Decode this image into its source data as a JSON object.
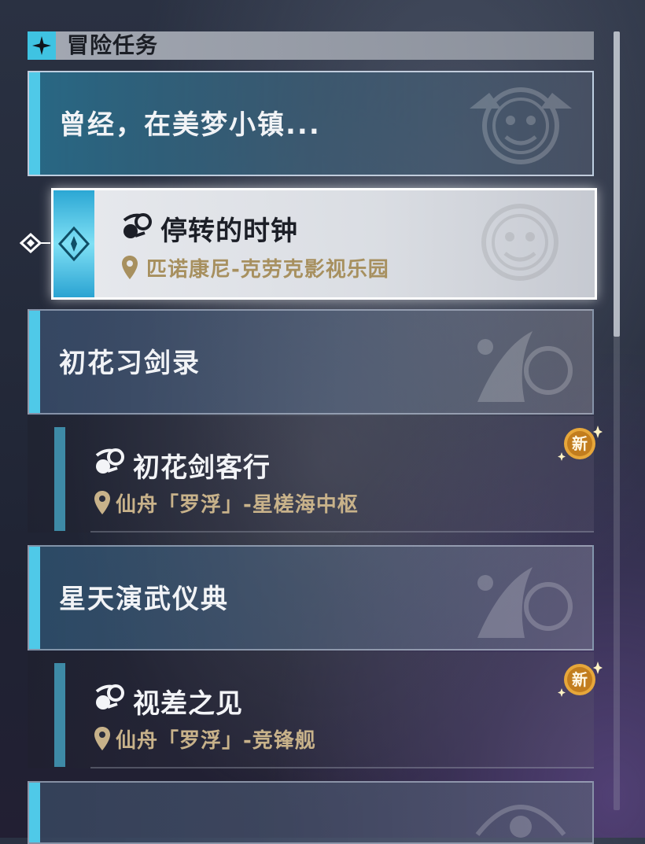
{
  "header": {
    "title": "冒险任务",
    "icon": "diamond-star-icon"
  },
  "categories": [
    {
      "title": "曾经，在美梦小镇...",
      "emblem": "clock-face-emblem"
    },
    {
      "title": "初花习剑录",
      "emblem": "xianzhou-emblem"
    },
    {
      "title": "星天演武仪典",
      "emblem": "xianzhou-emblem"
    },
    {
      "title": "",
      "emblem": "penacony-emblem"
    }
  ],
  "missions": [
    {
      "title": "停转的时钟",
      "location": "匹诺康尼-克劳克影视乐园",
      "selected": true,
      "is_new": false,
      "icon": "adventure-mission-icon"
    },
    {
      "title": "初花剑客行",
      "location": "仙舟「罗浮」-星槎海中枢",
      "selected": false,
      "is_new": true,
      "icon": "adventure-mission-icon"
    },
    {
      "title": "视差之见",
      "location": "仙舟「罗浮」-竞锋舰",
      "selected": false,
      "is_new": true,
      "icon": "adventure-mission-icon"
    }
  ],
  "badge": {
    "new_label": "新"
  },
  "colors": {
    "accent": "#4fc9e8",
    "location_text": "#c8b28a",
    "badge": "#e7a73a"
  }
}
